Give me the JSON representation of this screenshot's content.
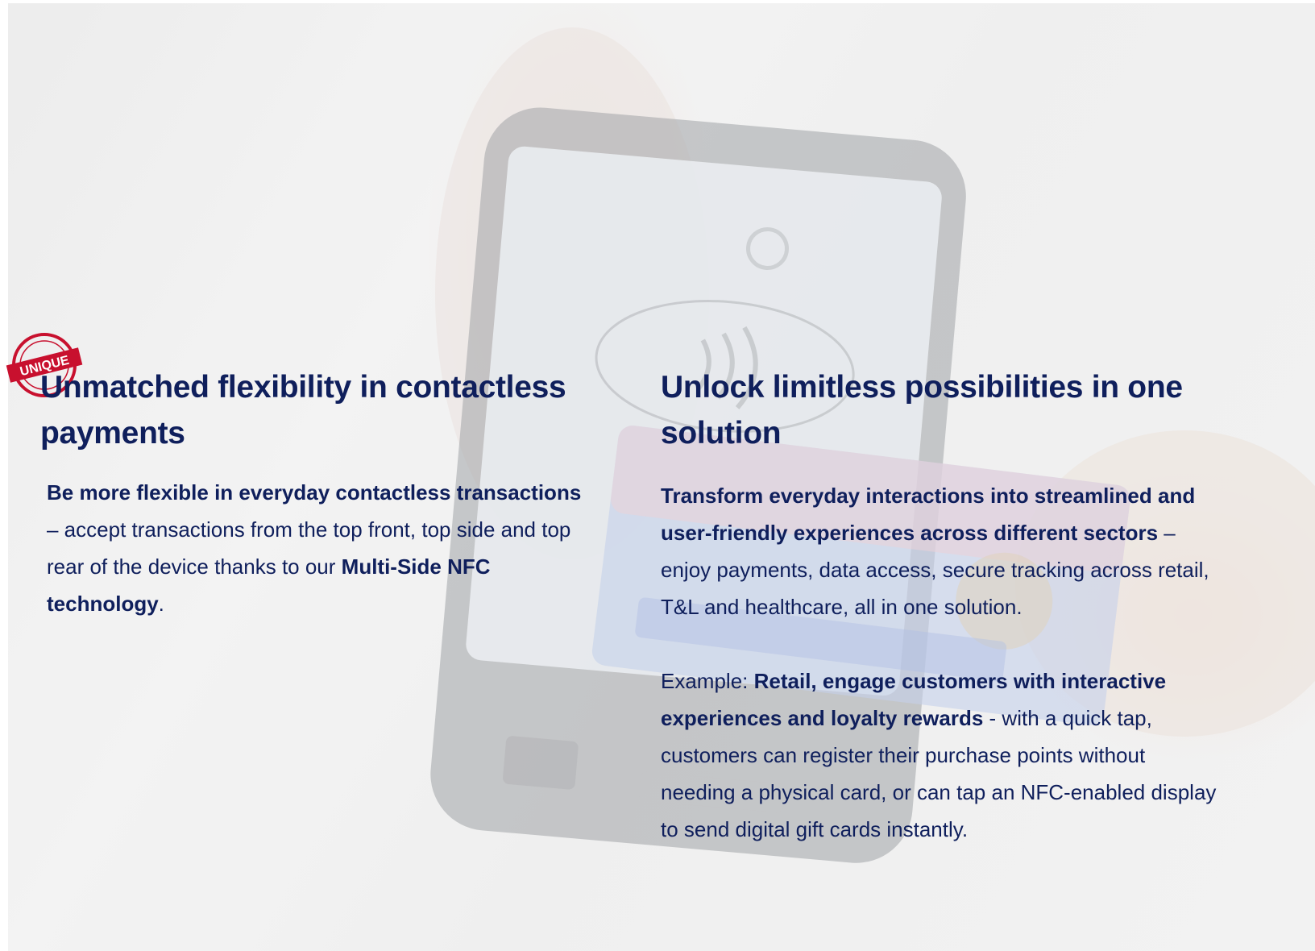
{
  "left": {
    "stamp_text": "UNIQUE",
    "title": "Unmatched flexibility in contactless payments",
    "para": {
      "bold_1": "Be more flexible in everyday contactless transactions",
      "text_1": " – accept transactions from the top front, top side and top rear of the device thanks to our ",
      "bold_2": "Multi-Side NFC technology",
      "text_2": "."
    }
  },
  "right": {
    "title": "Unlock limitless possibilities in one solution",
    "para1": {
      "bold": "Transform everyday interactions into streamlined and user-friendly experiences across different sectors",
      "text": " – enjoy payments, data access, secure tracking across retail, T&L and healthcare, all in one solution."
    },
    "para2": {
      "prefix": "Example:  ",
      "bold": "Retail, engage customers with interactive experiences and loyalty rewards",
      "text": " - with a quick tap, customers can register their purchase points without needing a physical card, or can tap an NFC-enabled display to send digital gift cards instantly."
    }
  },
  "colors": {
    "text": "#0f1f5c",
    "stamp": "#c8102e"
  }
}
